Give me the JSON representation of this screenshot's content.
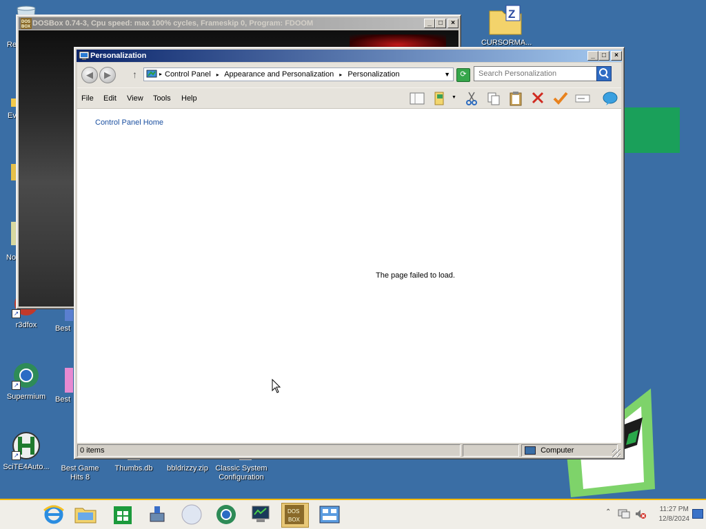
{
  "desktop": {
    "icons": [
      {
        "label": "r3dfox"
      },
      {
        "label": "Supermium"
      },
      {
        "label": "SciTE4Auto..."
      },
      {
        "label": "Best Game Hits 8"
      },
      {
        "label": "Thumbs.db"
      },
      {
        "label": "bbldrizzy.zip"
      },
      {
        "label": "Classic System Configuration"
      },
      {
        "label": "CURSORMA..."
      }
    ],
    "partial_labels": [
      "Re",
      "Ev",
      "No",
      "Best",
      "Best"
    ]
  },
  "dosbox": {
    "title": "DOSBox 0.74-3, Cpu speed: max 100% cycles, Frameskip 0, Program: FDOOM"
  },
  "explorer": {
    "title": "Personalization",
    "breadcrumb": [
      "Control Panel",
      "Appearance and Personalization",
      "Personalization"
    ],
    "search_placeholder": "Search Personalization",
    "menu": {
      "file": "File",
      "edit": "Edit",
      "view": "View",
      "tools": "Tools",
      "help": "Help"
    },
    "link_home": "Control Panel Home",
    "message": "The page failed to load.",
    "status_items": "0 items",
    "status_zone": "Computer"
  },
  "taskbar": {
    "time": "11:27 PM",
    "date": "12/8/2024"
  },
  "colors": {
    "desktop": "#3a6ea5",
    "title_active": "#0a246a",
    "link": "#1a4fa0",
    "taskbar_accent": "#f5b800"
  }
}
